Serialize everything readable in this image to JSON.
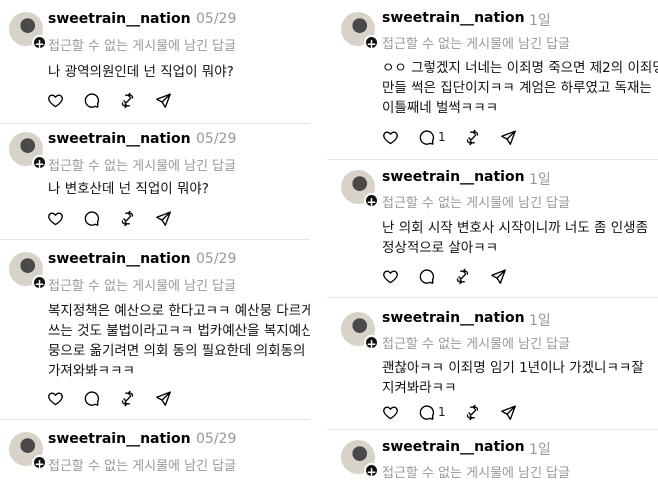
{
  "left_column": {
    "posts": [
      {
        "username": "sweetrain__nation",
        "date": "05/29",
        "subtitle": "접근할 수 없는 게시물에 남긴 답글",
        "lines": [
          "나 광역의원인데 넌 직업이 뭐야?"
        ]
      },
      {
        "username": "sweetrain__nation",
        "date": "05/29",
        "subtitle": "접근할 수 없는 게시물에 남긴 답글",
        "lines": [
          "나 변호산데 넌 직업이 뭐야?"
        ]
      },
      {
        "username": "sweetrain__nation",
        "date": "05/29",
        "subtitle": "접근할 수 없는 게시물에 남긴 답글",
        "lines": [
          "복지정책은 예산으로 한다고ㅋㅋ 예산뭉 다르게",
          "쓰는 것도 불법이라고ㅋㅋ 법카예산을 복지예산",
          "뭉으로 옮기려면 의회 동의 필요한데 의회동의",
          "가져와봐ㅋㅋㅋ"
        ]
      },
      {
        "username": "sweetrain__nation",
        "date": "05/29",
        "subtitle": "접근할 수 없는 게시물에 남긴 답글",
        "lines": []
      }
    ]
  },
  "right_column": {
    "posts": [
      {
        "username": "sweetrain__nation",
        "date": "1일",
        "subtitle": "접근할 수 없는 게시물에 남긴 답글",
        "lines": [
          "ㅇㅇ 그렇겠지 너네는 이죄명 죽으면 제2의 이죄명",
          "만들 썩은 집단이지ㅋㅋ 계엄은 하루였고 독재는",
          "이틀째네 벌썩ㅋㅋㅋ"
        ],
        "reply_count": "1"
      },
      {
        "username": "sweetrain__nation",
        "date": "1일",
        "subtitle": "접근할 수 없는 게시물에 남긴 답글",
        "lines": [
          "난 의회 시작 변호사 시작이니까 너도 좀 인생좀",
          "정상적으로 살아ㅋㅋ"
        ]
      },
      {
        "username": "sweetrain__nation",
        "date": "1일",
        "subtitle": "접근할 수 없는 게시물에 남긴 답글",
        "lines": [
          "괜찮아ㅋㅋ 이죄명 임기 1년이나 가겠니ㅋㅋ잘",
          "지켜봐라ㅋㅋ"
        ],
        "reply_count": "1"
      },
      {
        "username": "sweetrain__nation",
        "date": "1일",
        "subtitle": "접근할 수 없는 게시물에 남긴 답글",
        "lines": []
      }
    ]
  },
  "icons": {
    "like": "heart-icon",
    "reply": "speech-bubble-icon",
    "repost": "repost-icon",
    "share": "send-icon",
    "follow": "plus-icon"
  }
}
